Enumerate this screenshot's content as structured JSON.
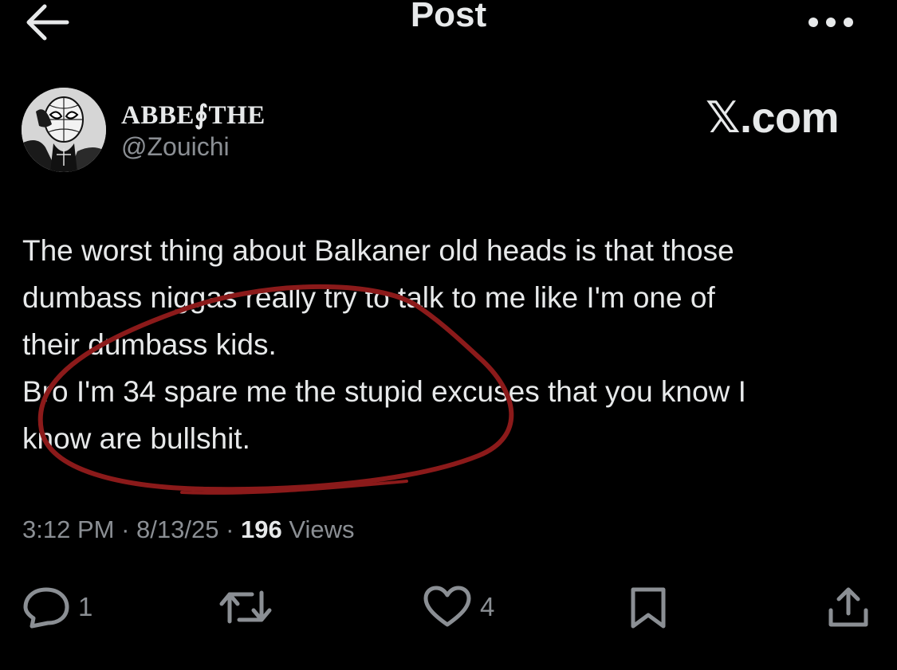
{
  "header": {
    "title": "Post",
    "back_icon": "arrow-left-icon",
    "more_icon": "more-horizontal-icon"
  },
  "author": {
    "display_name": "ABBE∮THE",
    "handle": "@Zouichi",
    "avatar_icon": "spider-man-avatar"
  },
  "watermark": {
    "x_letter": "𝕏",
    "suffix": ".com"
  },
  "post": {
    "lines": [
      "The worst thing about Balkaner old heads is that those",
      "dumbass niggas really try to talk to me like I'm one of",
      "their dumbass kids.",
      "Bro I'm 34 spare me the stupid excuses that you know I",
      "know are bullshit."
    ]
  },
  "meta": {
    "time": "3:12 PM",
    "separator": "·",
    "date": "8/13/25",
    "views_count": "196",
    "views_label": "Views"
  },
  "actions": {
    "reply_count": "1",
    "repost_count": "",
    "like_count": "4"
  },
  "colors": {
    "background": "#000000",
    "text_primary": "#e7e9ea",
    "text_secondary": "#8b8f94",
    "annotation_red": "#8b1a1a"
  }
}
